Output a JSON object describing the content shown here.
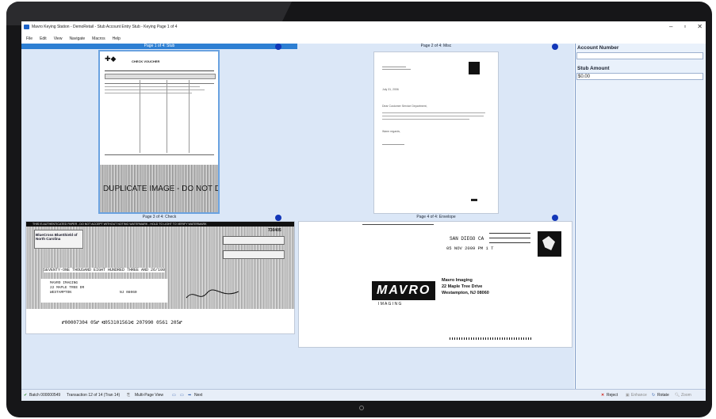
{
  "window": {
    "title": "Mavro Keying Station - DemoRetail - Stub Account Entry Stub - Keying Page 1 of 4",
    "controls": {
      "minimize": "–",
      "maximize": "▫",
      "close": "✕"
    }
  },
  "menu": [
    "File",
    "Edit",
    "View",
    "Navigate",
    "Macros",
    "Help"
  ],
  "panes": [
    {
      "header": "Page 1 of 4: Stub",
      "selected": true
    },
    {
      "header": "Page 2 of 4: Misc",
      "selected": false
    },
    {
      "header": "Page 3 of 4: Check",
      "selected": false
    },
    {
      "header": "Page 4 of 4: Envelope",
      "selected": false
    }
  ],
  "stub_doc": {
    "heading": "CHECK VOUCHER",
    "duplicate_text": "DUPLICATE IMAGE - DO NOT DEPOSIT"
  },
  "misc_doc": {
    "date": "July 31, 2006",
    "greeting": "Dear Customer Service Department,",
    "sign_off": "Warm regards,"
  },
  "check_doc": {
    "header_text": "THIS IS AUTHENTICATED PAPER - DO NOT ACCEPT WITHOUT NOTING WATERMARK - HOLD TO LIGHT TO VERIFY WATERMARK",
    "check_number": "730405",
    "bank_name": "BlueCross BlueShield of North Carolina",
    "amount_words": "SEVENTY-ONE THOUSAND EIGHT HUNDRED THREE AND 26/100",
    "payee_lines": [
      "MAVRO IMAGING",
      "22 MAPLE TREE DR",
      "WESTAMPTON",
      "NJ 08060"
    ],
    "micr": "⑈00007304 05⑈ ⑆053101561⑆ 207990 0561 205⑈"
  },
  "envelope_doc": {
    "postmark_city": "SAN DIEGO  CA",
    "postmark_date": "05 NOV 2009 PM 1 T",
    "logo": "MAVRO",
    "logo_sub": "I M A G I N G",
    "address": [
      "Mavro Imaging",
      "22 Maple Tree Drive",
      "Westampton, NJ 08060"
    ]
  },
  "right_panel": {
    "account_number_label": "Account Number",
    "account_number_value": "",
    "stub_amount_label": "Stub Amount",
    "stub_amount_value": "$0.00"
  },
  "status": {
    "batch": "Batch 000000549",
    "transaction": "Transaction 12 of 14 (Tran 14)",
    "view": "Multi-Page View",
    "next": "Next",
    "reject": "Reject",
    "enhance": "Enhance",
    "rotate": "Rotate",
    "zoom": "Zoom"
  },
  "colors": {
    "accent": "#2d7fd3",
    "marker": "#1237b8",
    "reject": "#d0241b"
  }
}
